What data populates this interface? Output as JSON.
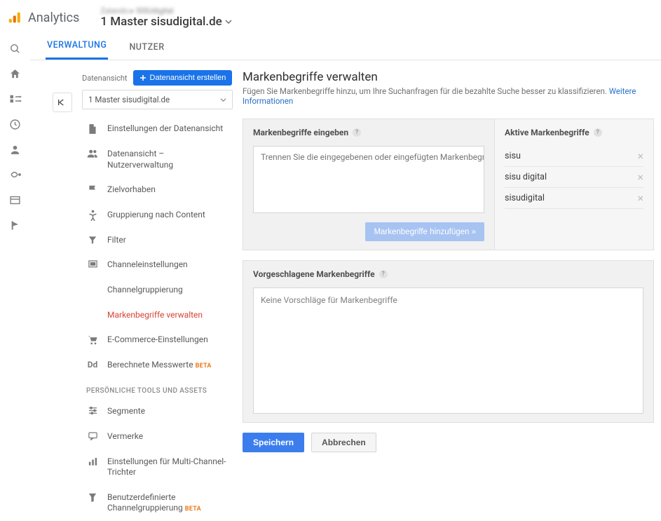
{
  "header": {
    "product": "Analytics",
    "breadcrumb_property": "SISUdigital",
    "view_name": "1 Master sisudigital.de"
  },
  "tabs": {
    "admin": "VERWALTUNG",
    "users": "NUTZER"
  },
  "view_col": {
    "label": "Datenansicht",
    "create_btn": "Datenansicht erstellen",
    "selected": "1 Master sisudigital.de"
  },
  "menu": {
    "settings": "Einstellungen der Datenansicht",
    "user_mgmt": "Datenansicht – Nutzerverwaltung",
    "goals": "Zielvorhaben",
    "content_group": "Gruppierung nach Content",
    "filter": "Filter",
    "channel": "Channeleinstellungen",
    "channel_group": "Channelgruppierung",
    "brand_terms": "Markenbegriffe verwalten",
    "ecom": "E-Commerce-Einstellungen",
    "calc": "Berechnete Messwerte",
    "calc_beta": "BETA",
    "section": "PERSÖNLICHE TOOLS UND ASSETS",
    "segments": "Segmente",
    "annotations": "Vermerke",
    "mcf": "Einstellungen für Multi-Channel-Trichter",
    "ccg": "Benutzerdefinierte Channelgruppierung",
    "ccg_beta": "BETA"
  },
  "content": {
    "title": "Markenbegriffe verwalten",
    "desc": "Fügen Sie Markenbegriffe hinzu, um Ihre Suchanfragen für die bezahlte Suche besser zu klassifizieren.",
    "more_info": "Weitere Informationen",
    "input_title": "Markenbegriffe eingeben",
    "placeholder": "Trennen Sie die eingegebenen oder eingefügten Markenbegriffe durch Zeilenumbrüche.",
    "add_btn": "Markenbegriffe hinzufügen »",
    "active_title": "Aktive Markenbegriffe",
    "terms": [
      "sisu",
      "sisu digital",
      "sisudigital"
    ],
    "suggest_title": "Vorgeschlagene Markenbegriffe",
    "suggest_empty": "Keine Vorschläge für Markenbegriffe",
    "save": "Speichern",
    "cancel": "Abbrechen"
  }
}
